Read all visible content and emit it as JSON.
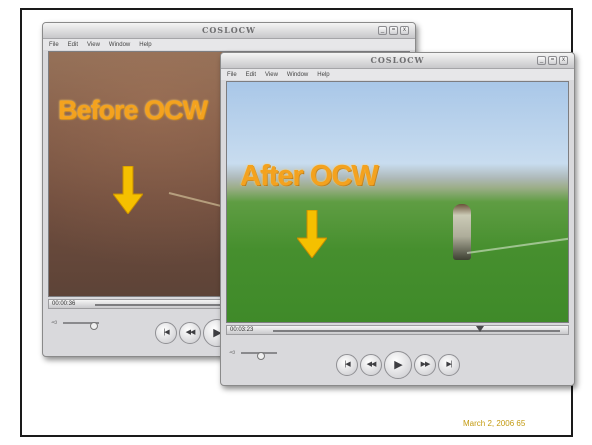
{
  "back_window": {
    "title": "COSLOCW",
    "menu": [
      "File",
      "Edit",
      "View",
      "Window",
      "Help"
    ],
    "overlay_label": "Before OCW",
    "timecode": "00:00:36",
    "win_controls": [
      "_",
      "=",
      "x"
    ],
    "playback_buttons": [
      "|◀",
      "◀◀",
      "▶"
    ],
    "seek_position": 0.76,
    "volume_level": 0.85
  },
  "front_window": {
    "title": "COSLOCW",
    "menu": [
      "File",
      "Edit",
      "View",
      "Window",
      "Help"
    ],
    "overlay_label": "After OCW",
    "timecode": "00:03:23",
    "win_controls": [
      "_",
      "=",
      "x"
    ],
    "playback_buttons": [
      "|◀",
      "◀◀",
      "▶",
      "▶▶",
      "▶|"
    ],
    "seek_position": 0.72,
    "volume_level": 0.55
  },
  "footer": {
    "date_page": "March 2, 2006   65"
  },
  "colors": {
    "overlay_orange": "#f4a21e",
    "arrow_yellow": "#f5c000",
    "footer_gold": "#c39a10"
  },
  "icons": {
    "arrow": "arrow-down-icon",
    "speaker": "speaker-icon"
  }
}
